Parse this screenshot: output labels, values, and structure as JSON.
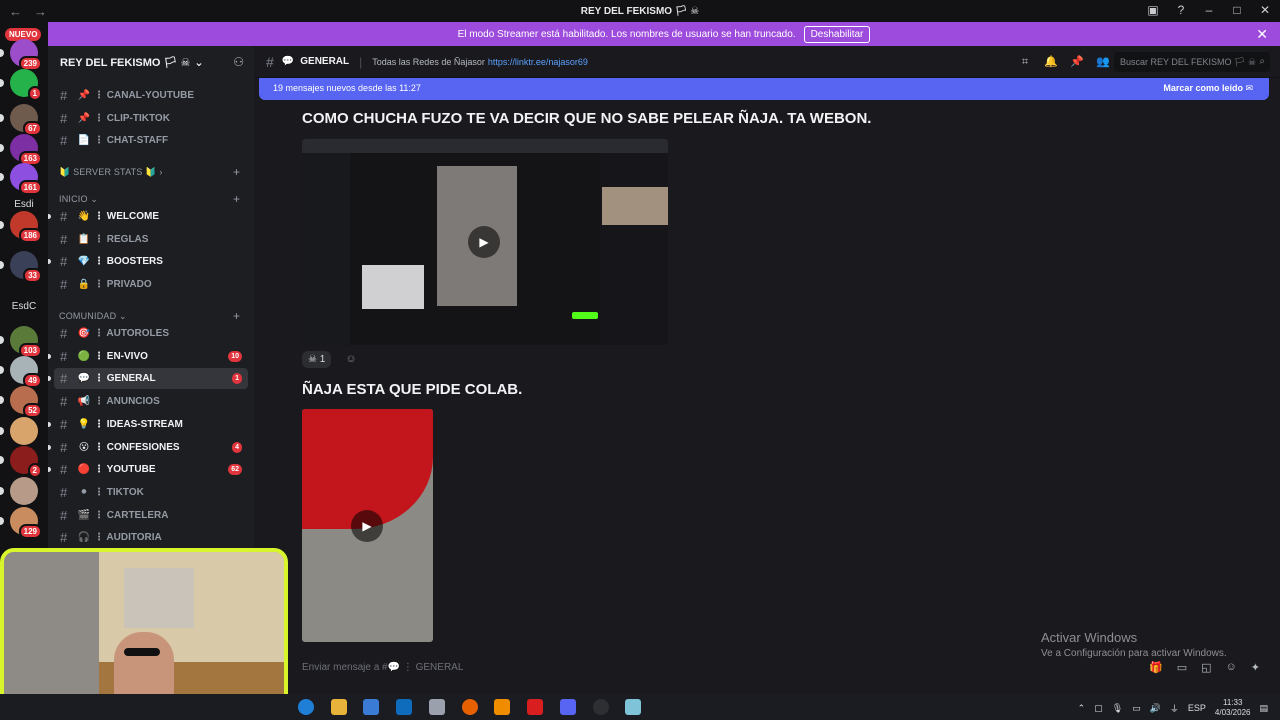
{
  "titlebar": {
    "title": "REY DEL FEKISMO 🏳 ☠"
  },
  "banner": {
    "text": "El modo Streamer está habilitado. Los nombres de usuario se han truncado.",
    "button": "Deshabilitar"
  },
  "rail": {
    "new_label": "NUEVO",
    "servers": [
      {
        "name": "server-1",
        "badge": "239",
        "color": "#9b4dca"
      },
      {
        "name": "server-2",
        "badge": "1",
        "color": "#26b24b"
      },
      {
        "name": "server-3",
        "badge": "67",
        "color": "#6f5b4d"
      },
      {
        "name": "server-4",
        "badge": "163",
        "color": "#7b2fa3"
      },
      {
        "name": "server-5",
        "badge": "161",
        "color": "#8c4fe0"
      },
      {
        "name": "server-6",
        "badge": "186",
        "color": "#c0392b"
      },
      {
        "name": "server-7",
        "badge": "33",
        "color": "#394057"
      },
      {
        "name": "server-8",
        "badge": "103",
        "color": "#5a7a3a"
      },
      {
        "name": "server-9",
        "badge": "49",
        "color": "#a8b3b8"
      },
      {
        "name": "server-10",
        "badge": "52",
        "color": "#b86e4e"
      },
      {
        "name": "server-11",
        "badge": "",
        "color": "#d9a46b"
      },
      {
        "name": "server-12",
        "badge": "2",
        "color": "#8b1d1d"
      },
      {
        "name": "server-13",
        "badge": "",
        "color": "#b79a88"
      },
      {
        "name": "server-14",
        "badge": "129",
        "color": "#c98c5e"
      }
    ],
    "labels": [
      "Esdi",
      "EsdC"
    ]
  },
  "sidebar": {
    "server_name": "REY DEL FEKISMO 🏳 ☠",
    "channels_top": [
      {
        "emoji": "📌",
        "name": "CANAL-YOUTUBE"
      },
      {
        "emoji": "📌",
        "name": "CLIP-TIKTOK"
      },
      {
        "emoji": "📄",
        "name": "CHAT-STAFF"
      }
    ],
    "categories": {
      "stats": "🔰 SERVER STATS 🔰",
      "inicio": "INICIO",
      "comunidad": "COMUNIDAD"
    },
    "inicio_channels": [
      {
        "emoji": "👋",
        "name": "WELCOME",
        "unread": true
      },
      {
        "emoji": "📋",
        "name": "REGLAS",
        "unread": false
      },
      {
        "emoji": "💎",
        "name": "BOOSTERS",
        "unread": true
      },
      {
        "emoji": "🔒",
        "name": "PRIVADO",
        "unread": false
      }
    ],
    "comunidad_channels": [
      {
        "emoji": "🎯",
        "name": "AUTOROLES",
        "unread": false,
        "count": ""
      },
      {
        "emoji": "🟢",
        "name": "EN-VIVO",
        "unread": true,
        "count": "10"
      },
      {
        "emoji": "💬",
        "name": "GENERAL",
        "unread": true,
        "count": "1",
        "active": true
      },
      {
        "emoji": "📢",
        "name": "ANUNCIOS",
        "unread": false,
        "count": ""
      },
      {
        "emoji": "💡",
        "name": "IDEAS-STREAM",
        "unread": true,
        "count": ""
      },
      {
        "emoji": "😮",
        "name": "CONFESIONES",
        "unread": true,
        "count": "4"
      },
      {
        "emoji": "🔴",
        "name": "YOUTUBE",
        "unread": true,
        "count": "62"
      },
      {
        "emoji": "⚫",
        "name": "TIKTOK",
        "unread": false,
        "count": ""
      },
      {
        "emoji": "🎬",
        "name": "CARTELERA",
        "unread": false,
        "count": ""
      },
      {
        "emoji": "🎧",
        "name": "AUDITORIA",
        "unread": false,
        "count": ""
      }
    ]
  },
  "header": {
    "channel": "GENERAL",
    "topic": "Todas las Redes de Ñajasor",
    "link": "https://linktr.ee/najasor69",
    "search_placeholder": "Buscar REY DEL FEKISMO 🏳 ☠"
  },
  "newbar": {
    "text": "19 mensajes nuevos desde las 11:27",
    "mark": "Marcar como leído"
  },
  "messages": {
    "m1": "COMO CHUCHA FUZO TE VA DECIR QUE NO SABE PELEAR ÑAJA. TA WEBON.",
    "reaction_count": "1",
    "m2": "ÑAJA ESTA QUE PIDE COLAB."
  },
  "composer": {
    "placeholder": "Enviar mensaje a #💬 ⋮ GENERAL"
  },
  "watermark": {
    "line1": "Activar Windows",
    "line2": "Ve a Configuración para activar Windows."
  },
  "taskbar": {
    "lang": "ESP",
    "time": "11:33",
    "date": "4/03/2026"
  }
}
